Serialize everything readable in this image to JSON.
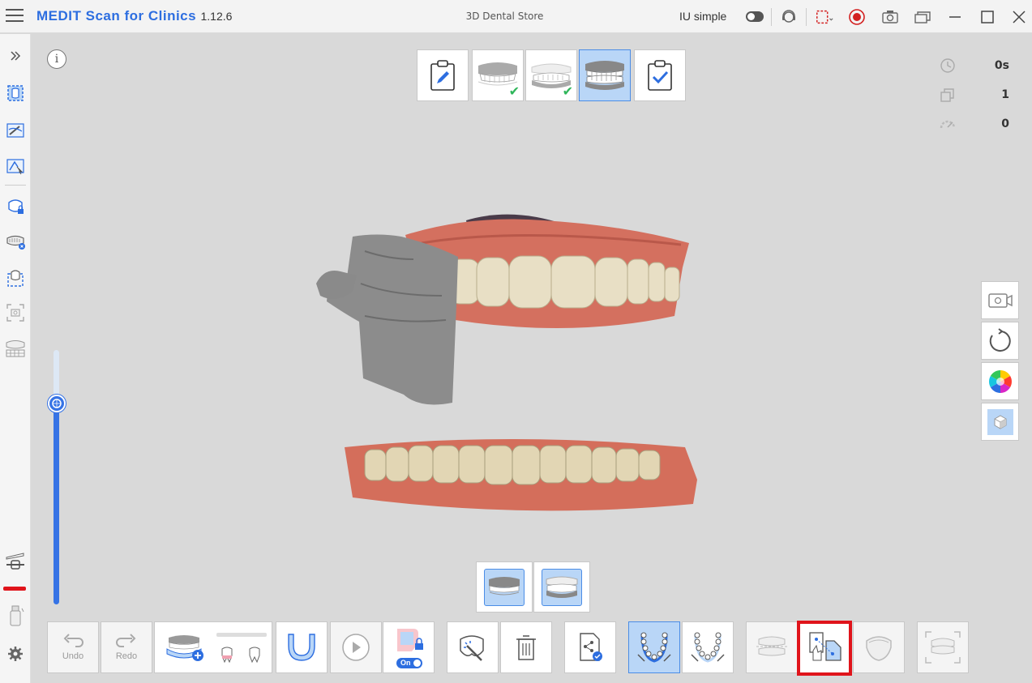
{
  "titlebar": {
    "brand": "MEDIT Scan for Clinics",
    "version": "1.12.6",
    "store": "3D Dental Store",
    "iu_label": "IU simple",
    "iu_toggle_on": false
  },
  "steps": [
    {
      "name": "patient-info",
      "icon": "clipboard-pencil-icon",
      "done": false,
      "active": false
    },
    {
      "name": "maxilla",
      "icon": "upper-jaw-icon",
      "done": true,
      "active": false
    },
    {
      "name": "mandible",
      "icon": "lower-jaw-icon",
      "done": true,
      "active": false
    },
    {
      "name": "occlusion",
      "icon": "occlusion-icon",
      "done": false,
      "active": true
    },
    {
      "name": "review",
      "icon": "clipboard-check-icon",
      "done": false,
      "active": false
    }
  ],
  "stats": {
    "time": "0s",
    "count": "1",
    "reliability": "0"
  },
  "slider": {
    "level": 0.79
  },
  "bottom_toolbar": {
    "undo_label": "Undo",
    "redo_label": "Redo",
    "ai_toggle_label": "On"
  },
  "colors": {
    "accent": "#2d6ee0",
    "active_bg": "#b9d6f7",
    "highlight": "#e0141b",
    "gum": "#d66f5e",
    "tooth": "#e6dcc0"
  }
}
